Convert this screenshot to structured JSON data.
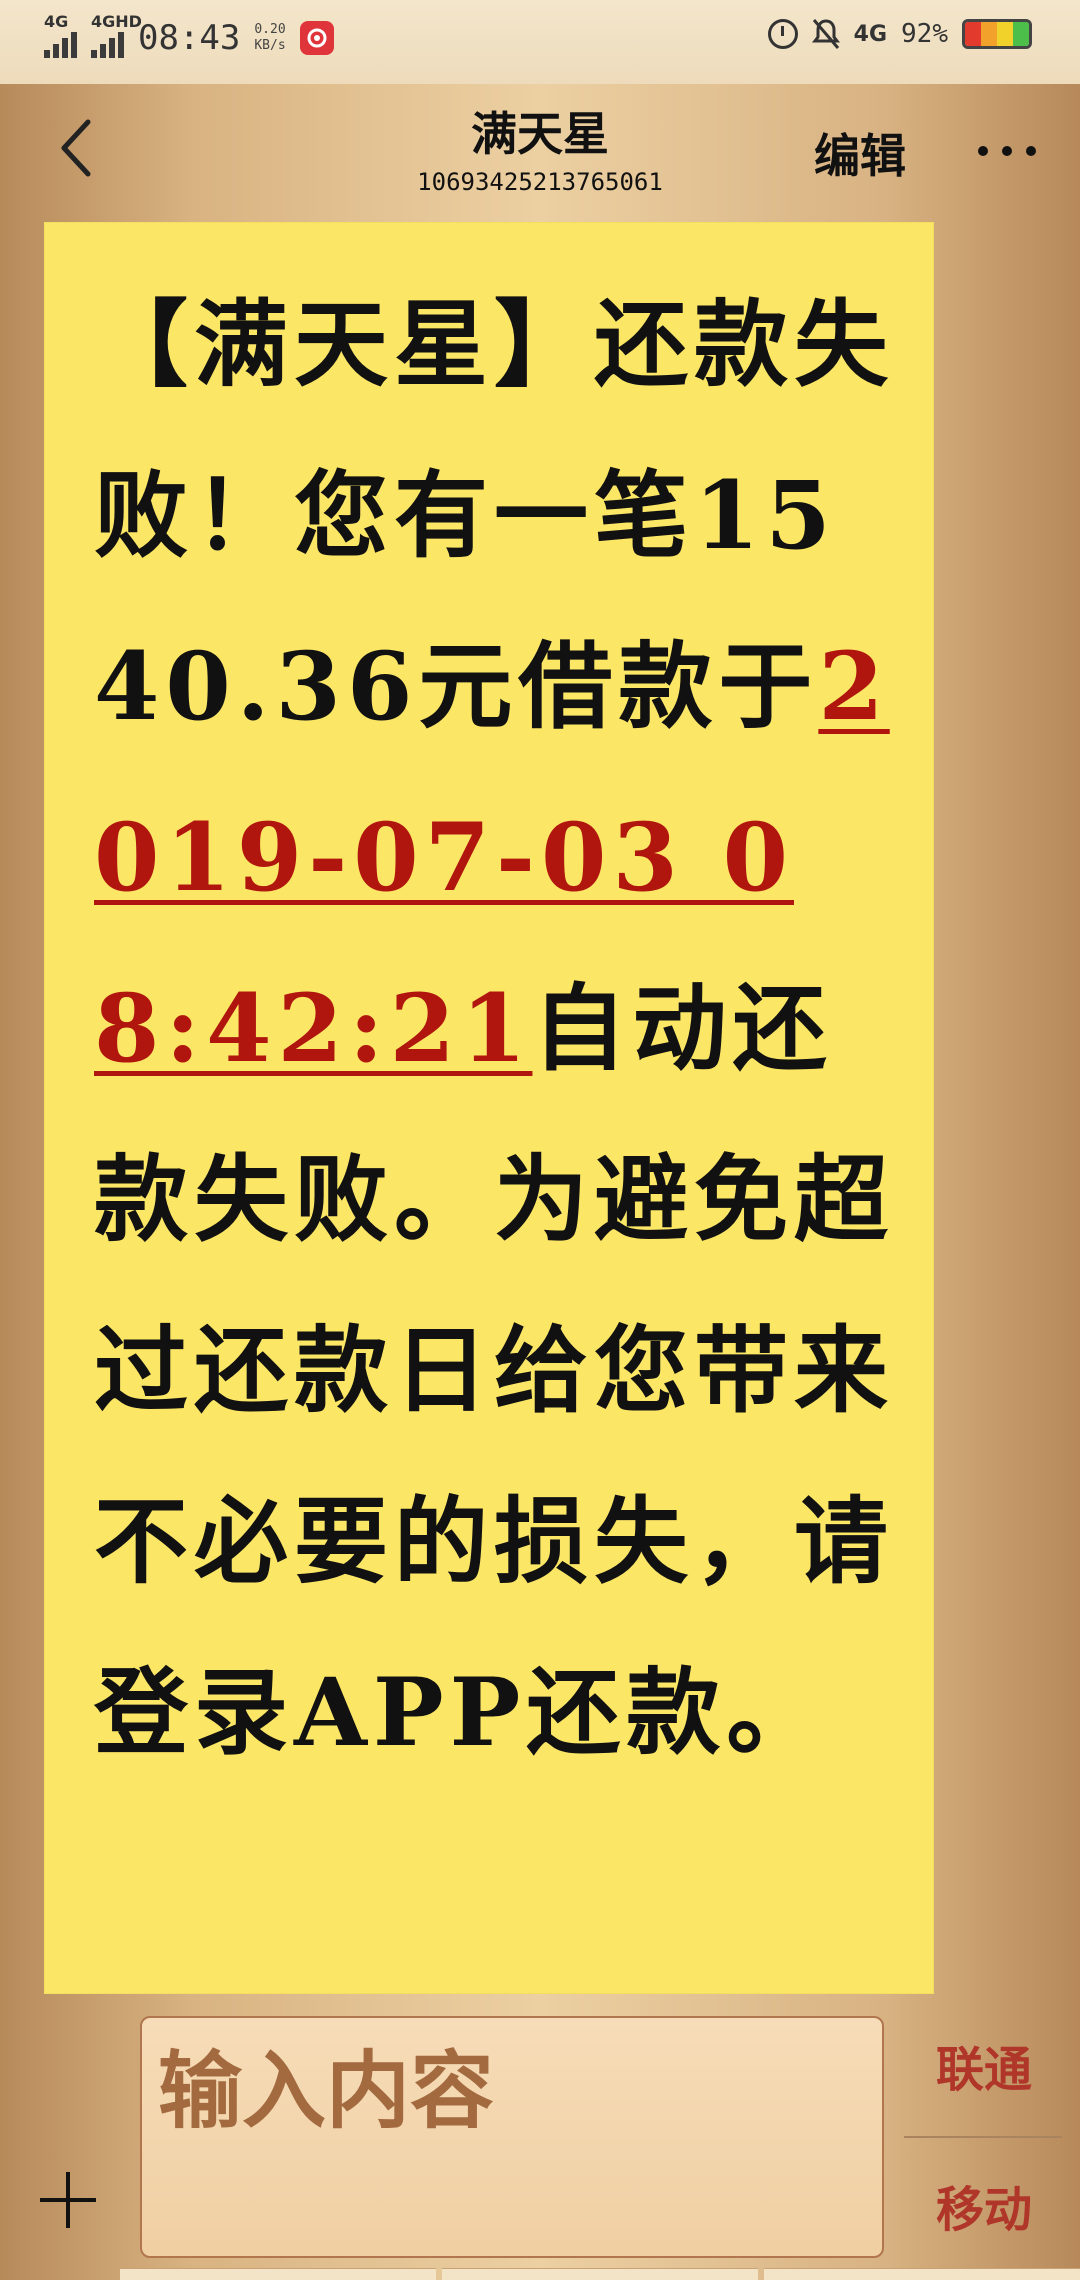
{
  "status_bar": {
    "network_1": "4G",
    "network_2": "4GHD",
    "time": "08:43",
    "speed_value": "0.20",
    "speed_unit": "KB/s",
    "right_network": "4G",
    "battery_percent": "92%",
    "icons": [
      "alarm-icon",
      "bell-off-icon",
      "battery-icon"
    ]
  },
  "header": {
    "title": "满天星",
    "number": "1069342521376506​1",
    "edit_label": "编辑"
  },
  "message": {
    "part1": "【满天星】还款失败！您有一笔1540.36元借款于",
    "datetime": "2019-07-03 08:42:21",
    "part2": "自动还款失败。为避免超过还款日给您带来不必要的损失，请登录APP还款。"
  },
  "composer": {
    "placeholder": "输入内容",
    "sim1_label": "联通",
    "sim2_label": "移动"
  },
  "colors": {
    "bubble": "#fbe666",
    "highlight": "#b0160e",
    "sim_label": "#b0362a"
  }
}
